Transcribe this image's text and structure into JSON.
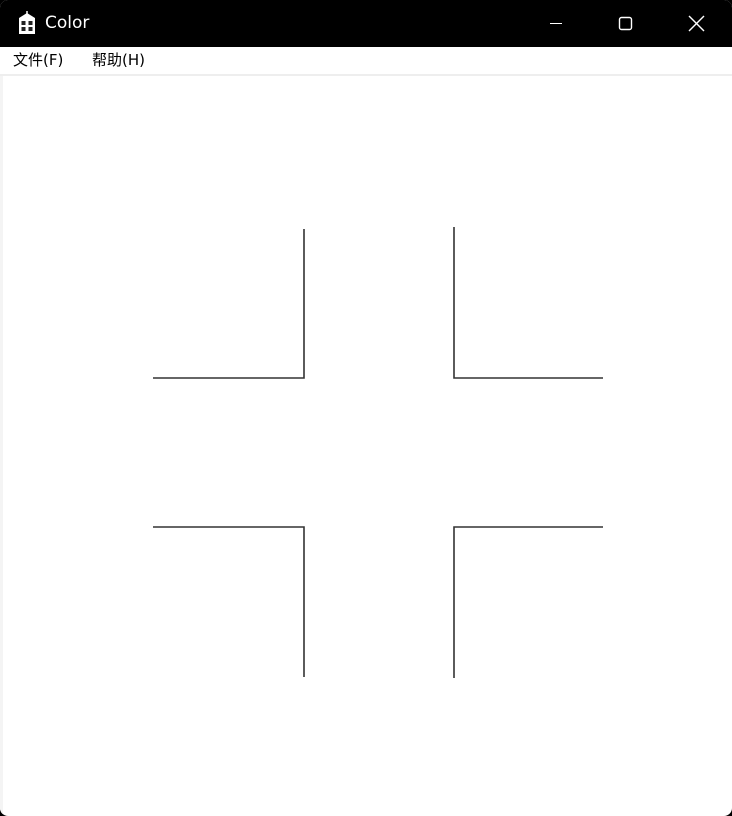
{
  "window": {
    "title": "Color",
    "icon": "building-app-icon",
    "controls": {
      "minimize": "minimize-icon",
      "maximize": "maximize-icon",
      "close": "close-icon"
    }
  },
  "menu": {
    "items": [
      {
        "label": "文件(F)"
      },
      {
        "label": "帮助(H)"
      }
    ]
  },
  "colors": {
    "titlebar": "#000000",
    "background": "#ffffff",
    "stroke": "#000000"
  }
}
